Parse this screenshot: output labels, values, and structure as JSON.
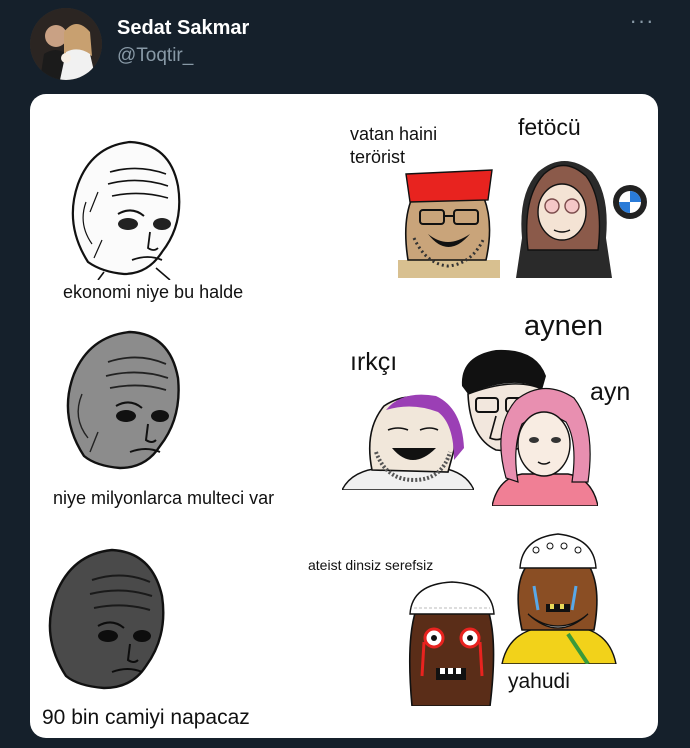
{
  "tweet": {
    "author_name": "Sedat Sakmar",
    "author_handle": "@Toqtir_",
    "more_icon": "more-horizontal-icon"
  },
  "meme": {
    "left_captions": [
      "ekonomi niye bu halde",
      "niye milyonlarca multeci var",
      "90 bin camiyi napacaz"
    ],
    "right": {
      "row1": {
        "label_a": "vatan haini",
        "label_b": "terörist",
        "label_c": "fetöcü"
      },
      "row2": {
        "label_a": "ırkçı",
        "label_b": "aynen",
        "label_c": "ayn"
      },
      "row3": {
        "label_a": "ateist dinsiz serefsiz",
        "label_b": "yahudi"
      }
    }
  },
  "colors": {
    "background": "#15202b",
    "name": "#ffffff",
    "secondary": "#8899a6",
    "media_bg": "#ffffff",
    "fez": "#e8231f",
    "hair_purple": "#9b3fb5",
    "hair_pink": "#e88fb0",
    "shirt_pink": "#f07f95",
    "shirt_yellow": "#f2d21a"
  }
}
